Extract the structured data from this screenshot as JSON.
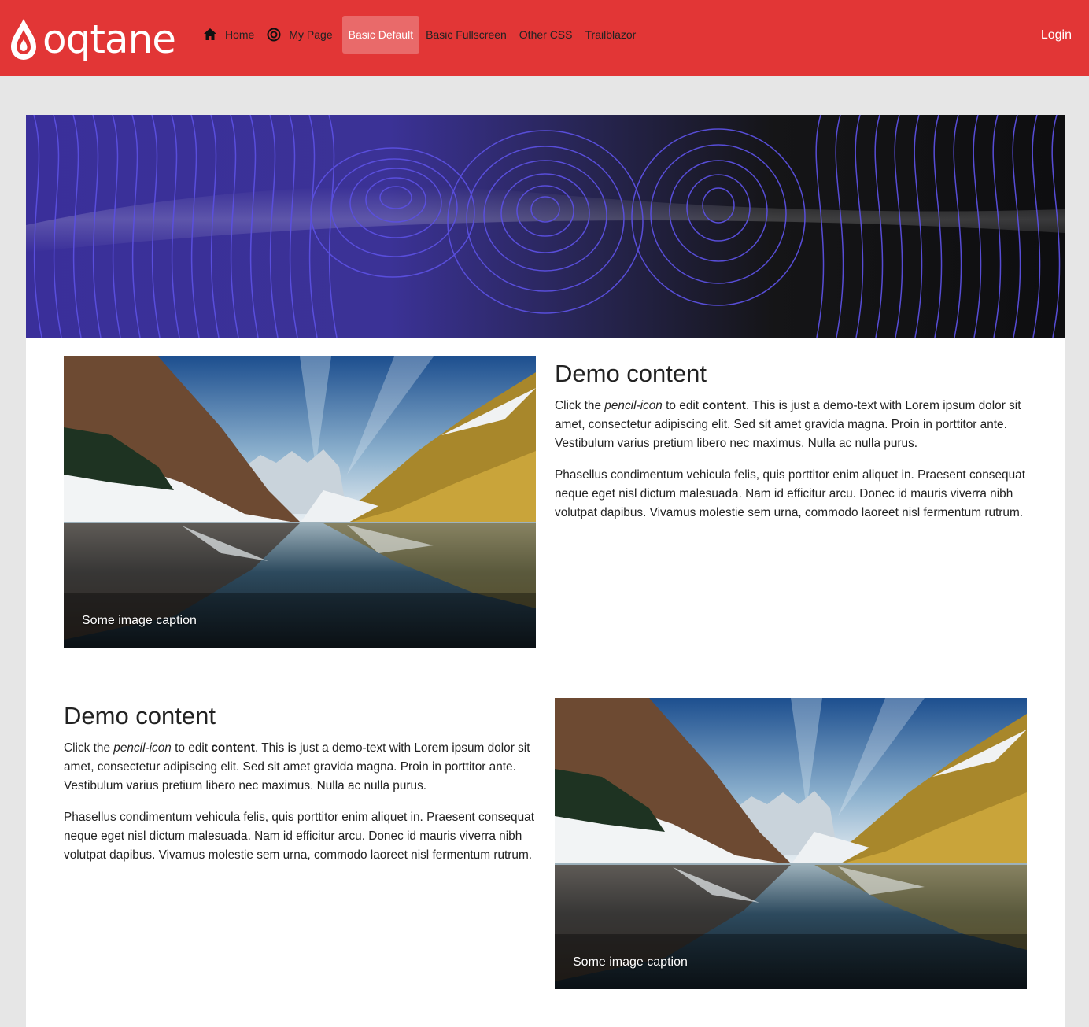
{
  "header": {
    "brand": "oqtane",
    "nav": [
      {
        "label": "Home",
        "icon": "home-icon"
      },
      {
        "label": "My Page",
        "icon": "target-icon"
      },
      {
        "label": "Basic Default",
        "active": true
      },
      {
        "label": "Basic Fullscreen"
      },
      {
        "label": "Other CSS"
      },
      {
        "label": "Trailblazor"
      }
    ],
    "login": "Login"
  },
  "colors": {
    "brand": "#e23636",
    "active_nav": "#e96a6a",
    "banner_lines": "#5b50e0"
  },
  "sections": [
    {
      "caption": "Some image caption",
      "title": "Demo content",
      "p1_pre": "Click the ",
      "p1_em": "pencil-icon",
      "p1_mid": " to edit ",
      "p1_strong": "content",
      "p1_post": ". This is just a demo-text with Lorem ipsum dolor sit amet, consectetur adipiscing elit. Sed sit amet gravida magna. Proin in porttitor ante. Vestibulum varius pretium libero nec maximus. Nulla ac nulla purus.",
      "p2": "Phasellus condimentum vehicula felis, quis porttitor enim aliquet in. Praesent consequat neque eget nisl dictum malesuada. Nam id efficitur arcu. Donec id mauris viverra nibh volutpat dapibus. Vivamus molestie sem urna, commodo laoreet nisl fermentum rutrum."
    },
    {
      "caption": "Some image caption",
      "title": "Demo content",
      "p1_pre": "Click the ",
      "p1_em": "pencil-icon",
      "p1_mid": " to edit ",
      "p1_strong": "content",
      "p1_post": ". This is just a demo-text with Lorem ipsum dolor sit amet, consectetur adipiscing elit. Sed sit amet gravida magna. Proin in porttitor ante. Vestibulum varius pretium libero nec maximus. Nulla ac nulla purus.",
      "p2": "Phasellus condimentum vehicula felis, quis porttitor enim aliquet in. Praesent consequat neque eget nisl dictum malesuada. Nam id efficitur arcu. Donec id mauris viverra nibh volutpat dapibus. Vivamus molestie sem urna, commodo laoreet nisl fermentum rutrum."
    }
  ]
}
